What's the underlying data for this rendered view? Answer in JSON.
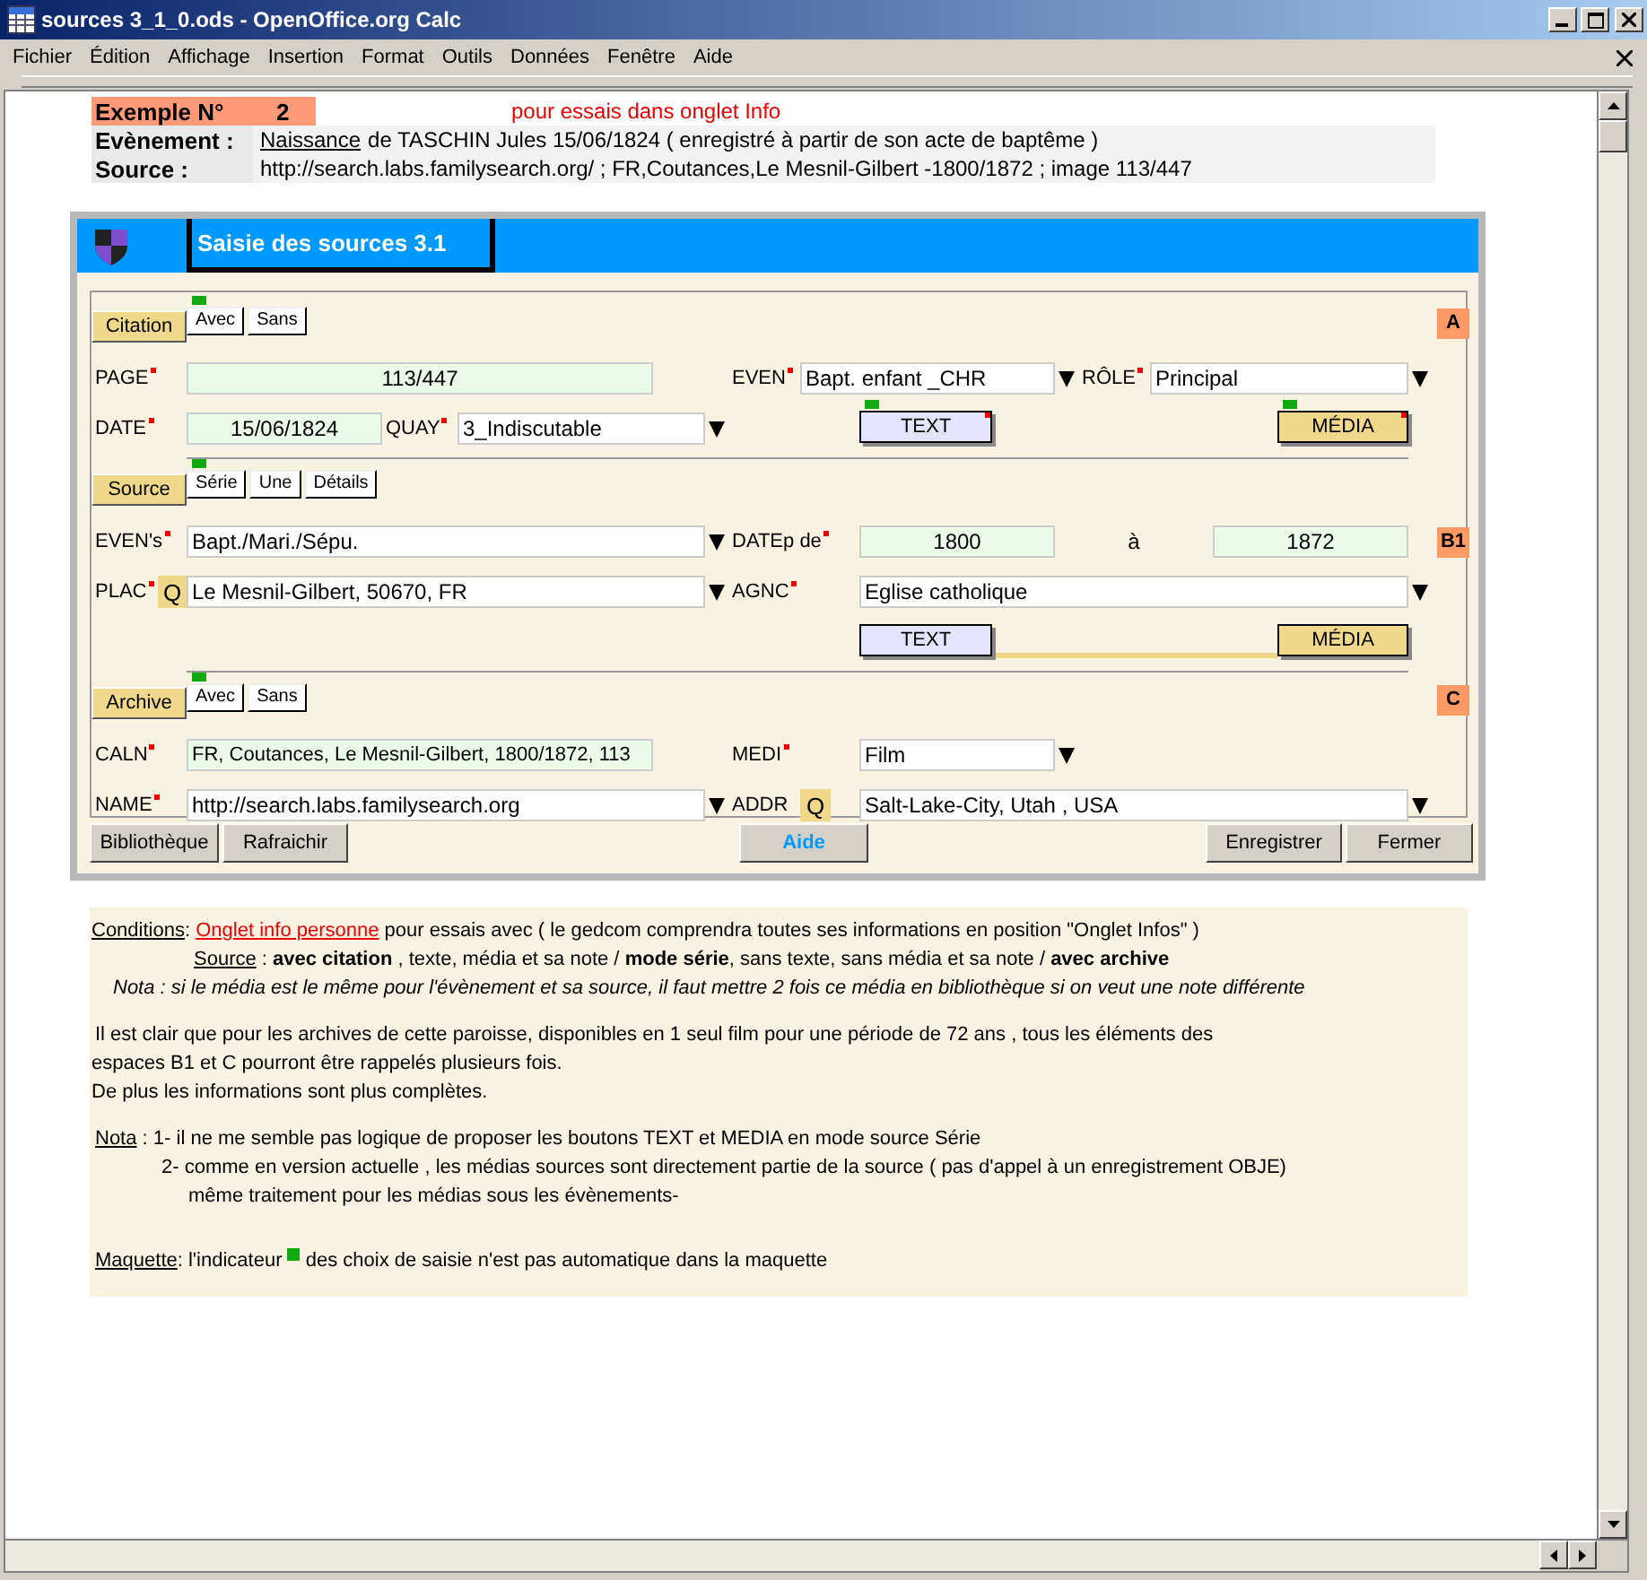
{
  "window": {
    "title": "sources 3_1_0.ods - OpenOffice.org Calc"
  },
  "menu": [
    "Fichier",
    "Édition",
    "Affichage",
    "Insertion",
    "Format",
    "Outils",
    "Données",
    "Fenêtre",
    "Aide"
  ],
  "header": {
    "example_label": "Exemple N°",
    "example_number": "2",
    "note": "pour essais dans onglet Info",
    "event_label": "Evènement :",
    "event_link": "Naissance",
    "event_text": "de TASCHIN Jules 15/06/1824 ( enregistré à partir de son acte de baptême )",
    "source_label": "Source :",
    "source_text": "http://search.labs.familysearch.org/ ; FR,Coutances,Le Mesnil-Gilbert -1800/1872 ; image 113/447"
  },
  "form": {
    "title": "Saisie des sources 3.1",
    "sections": [
      {
        "tab": "Citation",
        "marker": "A",
        "options": [
          {
            "label": "Avec",
            "selected": true
          },
          {
            "label": "Sans",
            "selected": false
          }
        ],
        "fields": [
          {
            "kind": "label",
            "text": "PAGE",
            "required": true
          },
          {
            "kind": "readonly",
            "text": "113/447"
          },
          {
            "kind": "label",
            "text": "EVEN",
            "required": true
          },
          {
            "kind": "combo",
            "text": "Bapt. enfant _CHR"
          },
          {
            "kind": "label",
            "text": "RÔLE",
            "required": true
          },
          {
            "kind": "combo",
            "text": "Principal"
          },
          {
            "kind": "label",
            "text": "DATE",
            "required": true
          },
          {
            "kind": "readonly",
            "text": "15/06/1824"
          },
          {
            "kind": "label",
            "text": "QUAY",
            "required": true
          },
          {
            "kind": "combo",
            "text": "3_Indiscutable"
          },
          {
            "kind": "text-button",
            "text": "TEXT",
            "indicator": true,
            "flag": true
          },
          {
            "kind": "media-button",
            "text": "MÉDIA",
            "indicator": true,
            "flag": true
          }
        ]
      },
      {
        "tab": "Source",
        "marker": "B1",
        "options": [
          {
            "label": "Série",
            "selected": true
          },
          {
            "label": "Une",
            "selected": false
          },
          {
            "label": "Détails",
            "selected": false
          }
        ],
        "fields": [
          {
            "kind": "label",
            "text": "EVEN's",
            "required": true
          },
          {
            "kind": "combo",
            "text": "Bapt./Mari./Sépu."
          },
          {
            "kind": "label",
            "text": "DATEp de",
            "required": true
          },
          {
            "kind": "readonly",
            "text": "1800"
          },
          {
            "kind": "plain",
            "text": "à"
          },
          {
            "kind": "readonly",
            "text": "1872"
          },
          {
            "kind": "label",
            "text": "PLAC",
            "required": true
          },
          {
            "kind": "lookup",
            "text": "Q"
          },
          {
            "kind": "combo",
            "text": "Le Mesnil-Gilbert, 50670, FR"
          },
          {
            "kind": "label",
            "text": "AGNC",
            "required": true
          },
          {
            "kind": "combo",
            "text": "Eglise catholique"
          },
          {
            "kind": "text-button",
            "text": "TEXT"
          },
          {
            "kind": "connector"
          },
          {
            "kind": "media-button",
            "text": "MÉDIA"
          }
        ]
      },
      {
        "tab": "Archive",
        "marker": "C",
        "options": [
          {
            "label": "Avec",
            "selected": true
          },
          {
            "label": "Sans",
            "selected": false
          }
        ],
        "fields": [
          {
            "kind": "label",
            "text": "CALN",
            "required": true
          },
          {
            "kind": "readonly-wide",
            "text": "FR, Coutances, Le Mesnil-Gilbert, 1800/1872, 113"
          },
          {
            "kind": "label",
            "text": "MEDI",
            "required": true
          },
          {
            "kind": "combo",
            "text": "Film"
          },
          {
            "kind": "label",
            "text": "NAME",
            "required": true
          },
          {
            "kind": "combo",
            "text": "http://search.labs.familysearch.org"
          },
          {
            "kind": "label",
            "text": "ADDR",
            "required": false
          },
          {
            "kind": "lookup",
            "text": "Q"
          },
          {
            "kind": "combo",
            "text": "Salt-Lake-City, Utah , USA"
          }
        ]
      }
    ],
    "buttons": [
      {
        "text": "Bibliothèque",
        "kind": "plain"
      },
      {
        "text": "Rafraichir",
        "kind": "plain"
      },
      {
        "text": "Aide",
        "kind": "help"
      },
      {
        "text": "Enregistrer",
        "kind": "plain"
      },
      {
        "text": "Fermer",
        "kind": "plain"
      }
    ]
  },
  "notes": [
    {
      "kind": "first",
      "parts": [
        {
          "kind": "underline",
          "text": "Conditions"
        },
        {
          "kind": "plain",
          "text": ": "
        },
        {
          "kind": "link",
          "text": "Onglet info personne"
        },
        {
          "kind": "plain",
          "text": " pour essais avec ( le gedcom comprendra toutes ses informations en position \"Onglet Infos\" )"
        }
      ]
    },
    {
      "kind": "indent",
      "parts": [
        {
          "kind": "underline",
          "text": "Source"
        },
        {
          "kind": "plain",
          "text": " : **avec citation** , texte, média et sa note / **mode série**, sans texte, sans média et sa note / **avec archive**"
        }
      ]
    },
    {
      "kind": "italic",
      "parts": [
        {
          "kind": "plain",
          "text": "Nota : si le média est le même pour l'évènement et sa source, il faut mettre 2 fois ce média en bibliothèque si on veut une note différente"
        }
      ]
    },
    {
      "kind": "para",
      "parts": [
        {
          "kind": "plain",
          "text": "Il est clair que pour les archives de cette paroisse, disponibles en 1 seul film pour une période de 72 ans , tous les éléments des"
        }
      ]
    },
    {
      "kind": "plain",
      "parts": [
        {
          "kind": "plain",
          "text": "espaces B1 et C pourront être rappelés plusieurs fois."
        }
      ]
    },
    {
      "kind": "plain",
      "parts": [
        {
          "kind": "plain",
          "text": "De plus les informations sont plus complètes."
        }
      ]
    },
    {
      "kind": "para",
      "parts": [
        {
          "kind": "underline",
          "text": "Nota"
        },
        {
          "kind": "plain",
          "text": " : 1- il ne me semble pas logique de proposer les boutons TEXT et MEDIA en mode source Série"
        }
      ]
    },
    {
      "kind": "cont1",
      "parts": [
        {
          "kind": "plain",
          "text": "2- comme en version actuelle , les médias sources sont directement partie de la source ( pas d'appel à un enregistrement OBJE)"
        }
      ]
    },
    {
      "kind": "cont2",
      "parts": [
        {
          "kind": "plain",
          "text": "même traitement pour les médias sous les évènements-"
        }
      ]
    },
    {
      "kind": "last",
      "parts": [
        {
          "kind": "underline",
          "text": "Maquette"
        },
        {
          "kind": "plain",
          "text": ": l'indicateur "
        },
        {
          "kind": "indicator"
        },
        {
          "kind": "plain",
          "text": " des choix de saisie n'est pas automatique dans la maquette"
        }
      ]
    }
  ]
}
